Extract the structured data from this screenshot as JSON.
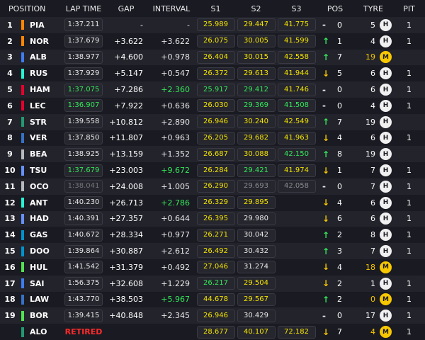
{
  "header": {
    "position": "POSITION",
    "lap_time": "LAP TIME",
    "gap": "GAP",
    "interval": "INTERVAL",
    "s1": "S1",
    "s2": "S2",
    "s3": "S3",
    "pos": "POS",
    "tyre": "TYRE",
    "pit": "PIT"
  },
  "rows": [
    {
      "pos": "1",
      "code": "PIA",
      "team": "#ff8700",
      "lap": "1:37.211",
      "lapc": "normal",
      "gap": "-",
      "int": "-",
      "intc": "white",
      "s1": "25.989",
      "s1c": "yellow",
      "s2": "29.447",
      "s2c": "yellow",
      "s3": "41.775",
      "s3c": "yellow",
      "dir": "flat",
      "dirsym": "-",
      "change": "0",
      "laps": "5",
      "lapsc": "white",
      "tyre": "H",
      "tyrec": "hard",
      "pit": "1"
    },
    {
      "pos": "2",
      "code": "NOR",
      "team": "#ff8700",
      "lap": "1:37.679",
      "lapc": "normal",
      "gap": "+3.622",
      "int": "+3.622",
      "intc": "white",
      "s1": "26.075",
      "s1c": "yellow",
      "s2": "30.005",
      "s2c": "yellow",
      "s3": "41.599",
      "s3c": "yellow",
      "dir": "up",
      "dirsym": "↑",
      "change": "1",
      "laps": "4",
      "lapsc": "white",
      "tyre": "H",
      "tyrec": "hard",
      "pit": "1"
    },
    {
      "pos": "3",
      "code": "ALB",
      "team": "#3e7cf0",
      "lap": "1:38.977",
      "lapc": "normal",
      "gap": "+4.600",
      "int": "+0.978",
      "intc": "white",
      "s1": "26.404",
      "s1c": "yellow",
      "s2": "30.015",
      "s2c": "yellow",
      "s3": "42.558",
      "s3c": "yellow",
      "dir": "up",
      "dirsym": "↑",
      "change": "7",
      "laps": "19",
      "lapsc": "orange",
      "tyre": "M",
      "tyrec": "medium",
      "pit": ""
    },
    {
      "pos": "4",
      "code": "RUS",
      "team": "#27f4d2",
      "lap": "1:37.929",
      "lapc": "normal",
      "gap": "+5.147",
      "int": "+0.547",
      "intc": "white",
      "s1": "26.372",
      "s1c": "yellow",
      "s2": "29.613",
      "s2c": "yellow",
      "s3": "41.944",
      "s3c": "yellow",
      "dir": "down",
      "dirsym": "↓",
      "change": "5",
      "laps": "6",
      "lapsc": "white",
      "tyre": "H",
      "tyrec": "hard",
      "pit": "1"
    },
    {
      "pos": "5",
      "code": "HAM",
      "team": "#e8002d",
      "lap": "1:37.075",
      "lapc": "best",
      "gap": "+7.286",
      "int": "+2.360",
      "intc": "green",
      "s1": "25.917",
      "s1c": "green",
      "s2": "29.412",
      "s2c": "green",
      "s3": "41.746",
      "s3c": "yellow",
      "dir": "flat",
      "dirsym": "-",
      "change": "0",
      "laps": "6",
      "lapsc": "white",
      "tyre": "H",
      "tyrec": "hard",
      "pit": "1"
    },
    {
      "pos": "6",
      "code": "LEC",
      "team": "#e8002d",
      "lap": "1:36.907",
      "lapc": "best",
      "gap": "+7.922",
      "int": "+0.636",
      "intc": "white",
      "s1": "26.030",
      "s1c": "yellow",
      "s2": "29.369",
      "s2c": "green",
      "s3": "41.508",
      "s3c": "green",
      "dir": "flat",
      "dirsym": "-",
      "change": "0",
      "laps": "4",
      "lapsc": "white",
      "tyre": "H",
      "tyrec": "hard",
      "pit": "1"
    },
    {
      "pos": "7",
      "code": "STR",
      "team": "#229971",
      "lap": "1:39.558",
      "lapc": "normal",
      "gap": "+10.812",
      "int": "+2.890",
      "intc": "white",
      "s1": "26.946",
      "s1c": "yellow",
      "s2": "30.240",
      "s2c": "yellow",
      "s3": "42.549",
      "s3c": "yellow",
      "dir": "up",
      "dirsym": "↑",
      "change": "7",
      "laps": "19",
      "lapsc": "white",
      "tyre": "H",
      "tyrec": "hard",
      "pit": ""
    },
    {
      "pos": "8",
      "code": "VER",
      "team": "#3671c6",
      "lap": "1:37.850",
      "lapc": "normal",
      "gap": "+11.807",
      "int": "+0.963",
      "intc": "white",
      "s1": "26.205",
      "s1c": "yellow",
      "s2": "29.682",
      "s2c": "yellow",
      "s3": "41.963",
      "s3c": "yellow",
      "dir": "down",
      "dirsym": "↓",
      "change": "4",
      "laps": "6",
      "lapsc": "white",
      "tyre": "H",
      "tyrec": "hard",
      "pit": "1"
    },
    {
      "pos": "9",
      "code": "BEA",
      "team": "#b6babd",
      "lap": "1:38.925",
      "lapc": "normal",
      "gap": "+13.159",
      "int": "+1.352",
      "intc": "white",
      "s1": "26.687",
      "s1c": "yellow",
      "s2": "30.088",
      "s2c": "yellow",
      "s3": "42.150",
      "s3c": "green",
      "dir": "up",
      "dirsym": "↑",
      "change": "8",
      "laps": "19",
      "lapsc": "white",
      "tyre": "H",
      "tyrec": "hard",
      "pit": ""
    },
    {
      "pos": "10",
      "code": "TSU",
      "team": "#6692ff",
      "lap": "1:37.679",
      "lapc": "best",
      "gap": "+23.003",
      "int": "+9.672",
      "intc": "green",
      "s1": "26.284",
      "s1c": "yellow",
      "s2": "29.421",
      "s2c": "green",
      "s3": "41.974",
      "s3c": "yellow",
      "dir": "down",
      "dirsym": "↓",
      "change": "1",
      "laps": "7",
      "lapsc": "white",
      "tyre": "H",
      "tyrec": "hard",
      "pit": "1"
    },
    {
      "pos": "11",
      "code": "OCO",
      "team": "#b6babd",
      "lap": "1:38.041",
      "lapc": "dim",
      "gap": "+24.008",
      "int": "+1.005",
      "intc": "white",
      "s1": "26.290",
      "s1c": "yellow",
      "s2": "29.693",
      "s2c": "dim",
      "s3": "42.058",
      "s3c": "dim",
      "dir": "flat",
      "dirsym": "-",
      "change": "0",
      "laps": "7",
      "lapsc": "white",
      "tyre": "H",
      "tyrec": "hard",
      "pit": "1"
    },
    {
      "pos": "12",
      "code": "ANT",
      "team": "#27f4d2",
      "lap": "1:40.230",
      "lapc": "normal",
      "gap": "+26.713",
      "int": "+2.786",
      "intc": "green",
      "s1": "26.329",
      "s1c": "yellow",
      "s2": "29.895",
      "s2c": "yellow",
      "s3": "",
      "s3c": "white",
      "dir": "down",
      "dirsym": "↓",
      "change": "4",
      "laps": "6",
      "lapsc": "white",
      "tyre": "H",
      "tyrec": "hard",
      "pit": "1"
    },
    {
      "pos": "13",
      "code": "HAD",
      "team": "#6692ff",
      "lap": "1:40.391",
      "lapc": "normal",
      "gap": "+27.357",
      "int": "+0.644",
      "intc": "white",
      "s1": "26.395",
      "s1c": "yellow",
      "s2": "29.980",
      "s2c": "white",
      "s3": "",
      "s3c": "white",
      "dir": "down",
      "dirsym": "↓",
      "change": "6",
      "laps": "6",
      "lapsc": "white",
      "tyre": "H",
      "tyrec": "hard",
      "pit": "1"
    },
    {
      "pos": "14",
      "code": "GAS",
      "team": "#0093cc",
      "lap": "1:40.672",
      "lapc": "normal",
      "gap": "+28.334",
      "int": "+0.977",
      "intc": "white",
      "s1": "26.271",
      "s1c": "yellow",
      "s2": "30.042",
      "s2c": "white",
      "s3": "",
      "s3c": "white",
      "dir": "up",
      "dirsym": "↑",
      "change": "2",
      "laps": "8",
      "lapsc": "white",
      "tyre": "H",
      "tyrec": "hard",
      "pit": "1"
    },
    {
      "pos": "15",
      "code": "DOO",
      "team": "#0093cc",
      "lap": "1:39.864",
      "lapc": "normal",
      "gap": "+30.887",
      "int": "+2.612",
      "intc": "white",
      "s1": "26.492",
      "s1c": "yellow",
      "s2": "30.432",
      "s2c": "white",
      "s3": "",
      "s3c": "white",
      "dir": "up",
      "dirsym": "↑",
      "change": "3",
      "laps": "7",
      "lapsc": "white",
      "tyre": "H",
      "tyrec": "hard",
      "pit": "1"
    },
    {
      "pos": "16",
      "code": "HUL",
      "team": "#52e252",
      "lap": "1:41.542",
      "lapc": "normal",
      "gap": "+31.379",
      "int": "+0.492",
      "intc": "white",
      "s1": "27.046",
      "s1c": "yellow",
      "s2": "31.274",
      "s2c": "white",
      "s3": "",
      "s3c": "white",
      "dir": "down",
      "dirsym": "↓",
      "change": "4",
      "laps": "18",
      "lapsc": "orange",
      "tyre": "M",
      "tyrec": "medium",
      "pit": ""
    },
    {
      "pos": "17",
      "code": "SAI",
      "team": "#3e7cf0",
      "lap": "1:56.375",
      "lapc": "normal",
      "gap": "+32.608",
      "int": "+1.229",
      "intc": "white",
      "s1": "26.217",
      "s1c": "green",
      "s2": "29.504",
      "s2c": "yellow",
      "s3": "",
      "s3c": "white",
      "dir": "down",
      "dirsym": "↓",
      "change": "2",
      "laps": "1",
      "lapsc": "white",
      "tyre": "H",
      "tyrec": "hard",
      "pit": "1"
    },
    {
      "pos": "18",
      "code": "LAW",
      "team": "#3671c6",
      "lap": "1:43.770",
      "lapc": "normal",
      "gap": "+38.503",
      "int": "+5.967",
      "intc": "green",
      "s1": "44.678",
      "s1c": "yellow",
      "s2": "29.567",
      "s2c": "yellow",
      "s3": "",
      "s3c": "white",
      "dir": "up",
      "dirsym": "↑",
      "change": "2",
      "laps": "0",
      "lapsc": "orange",
      "tyre": "M",
      "tyrec": "medium",
      "pit": "1"
    },
    {
      "pos": "19",
      "code": "BOR",
      "team": "#52e252",
      "lap": "1:39.415",
      "lapc": "normal",
      "gap": "+40.848",
      "int": "+2.345",
      "intc": "white",
      "s1": "26.946",
      "s1c": "yellow",
      "s2": "30.429",
      "s2c": "white",
      "s3": "",
      "s3c": "white",
      "dir": "flat",
      "dirsym": "-",
      "change": "0",
      "laps": "17",
      "lapsc": "white",
      "tyre": "H",
      "tyrec": "hard",
      "pit": "1"
    },
    {
      "pos": "",
      "code": "ALO",
      "team": "#229971",
      "lap": "RETIRED",
      "lapc": "retired",
      "gap": "",
      "int": "",
      "intc": "white",
      "s1": "28.677",
      "s1c": "yellow",
      "s2": "40.107",
      "s2c": "yellow",
      "s3": "72.182",
      "s3c": "yellow",
      "dir": "down",
      "dirsym": "↓",
      "change": "7",
      "laps": "4",
      "lapsc": "orange",
      "tyre": "M",
      "tyrec": "medium",
      "pit": "1"
    }
  ]
}
